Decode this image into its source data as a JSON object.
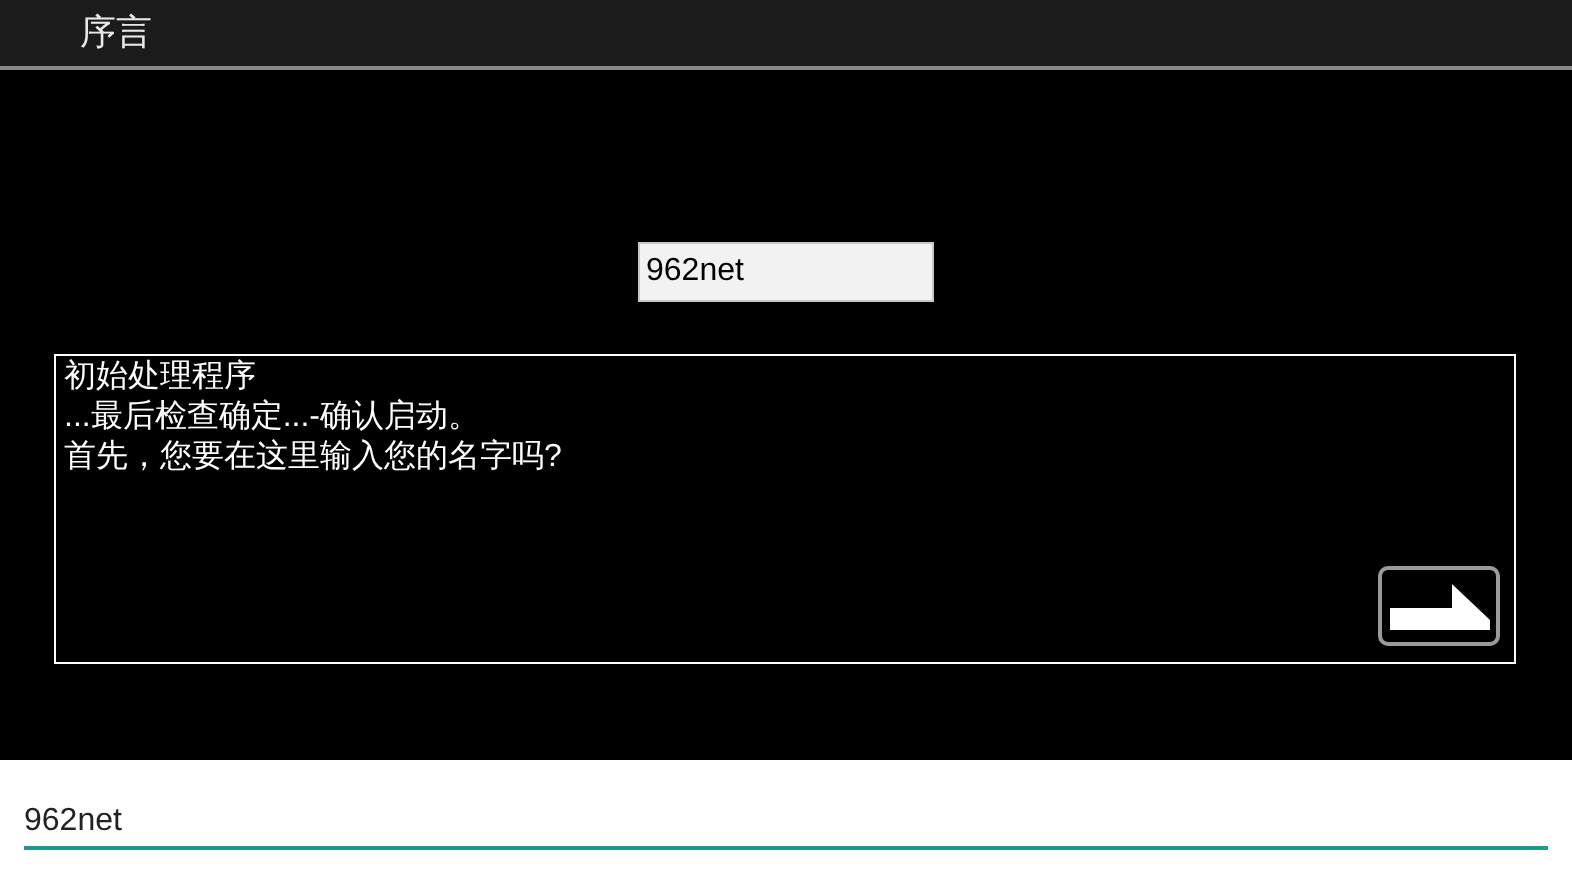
{
  "window": {
    "title": "序言"
  },
  "name_field": {
    "value": "962net"
  },
  "dialog": {
    "lines": [
      "初始处理程序",
      "...最后检查确定...-确认启动。",
      "首先，您要在这里输入您的名字吗?"
    ]
  },
  "input_bar": {
    "value": "962net"
  }
}
